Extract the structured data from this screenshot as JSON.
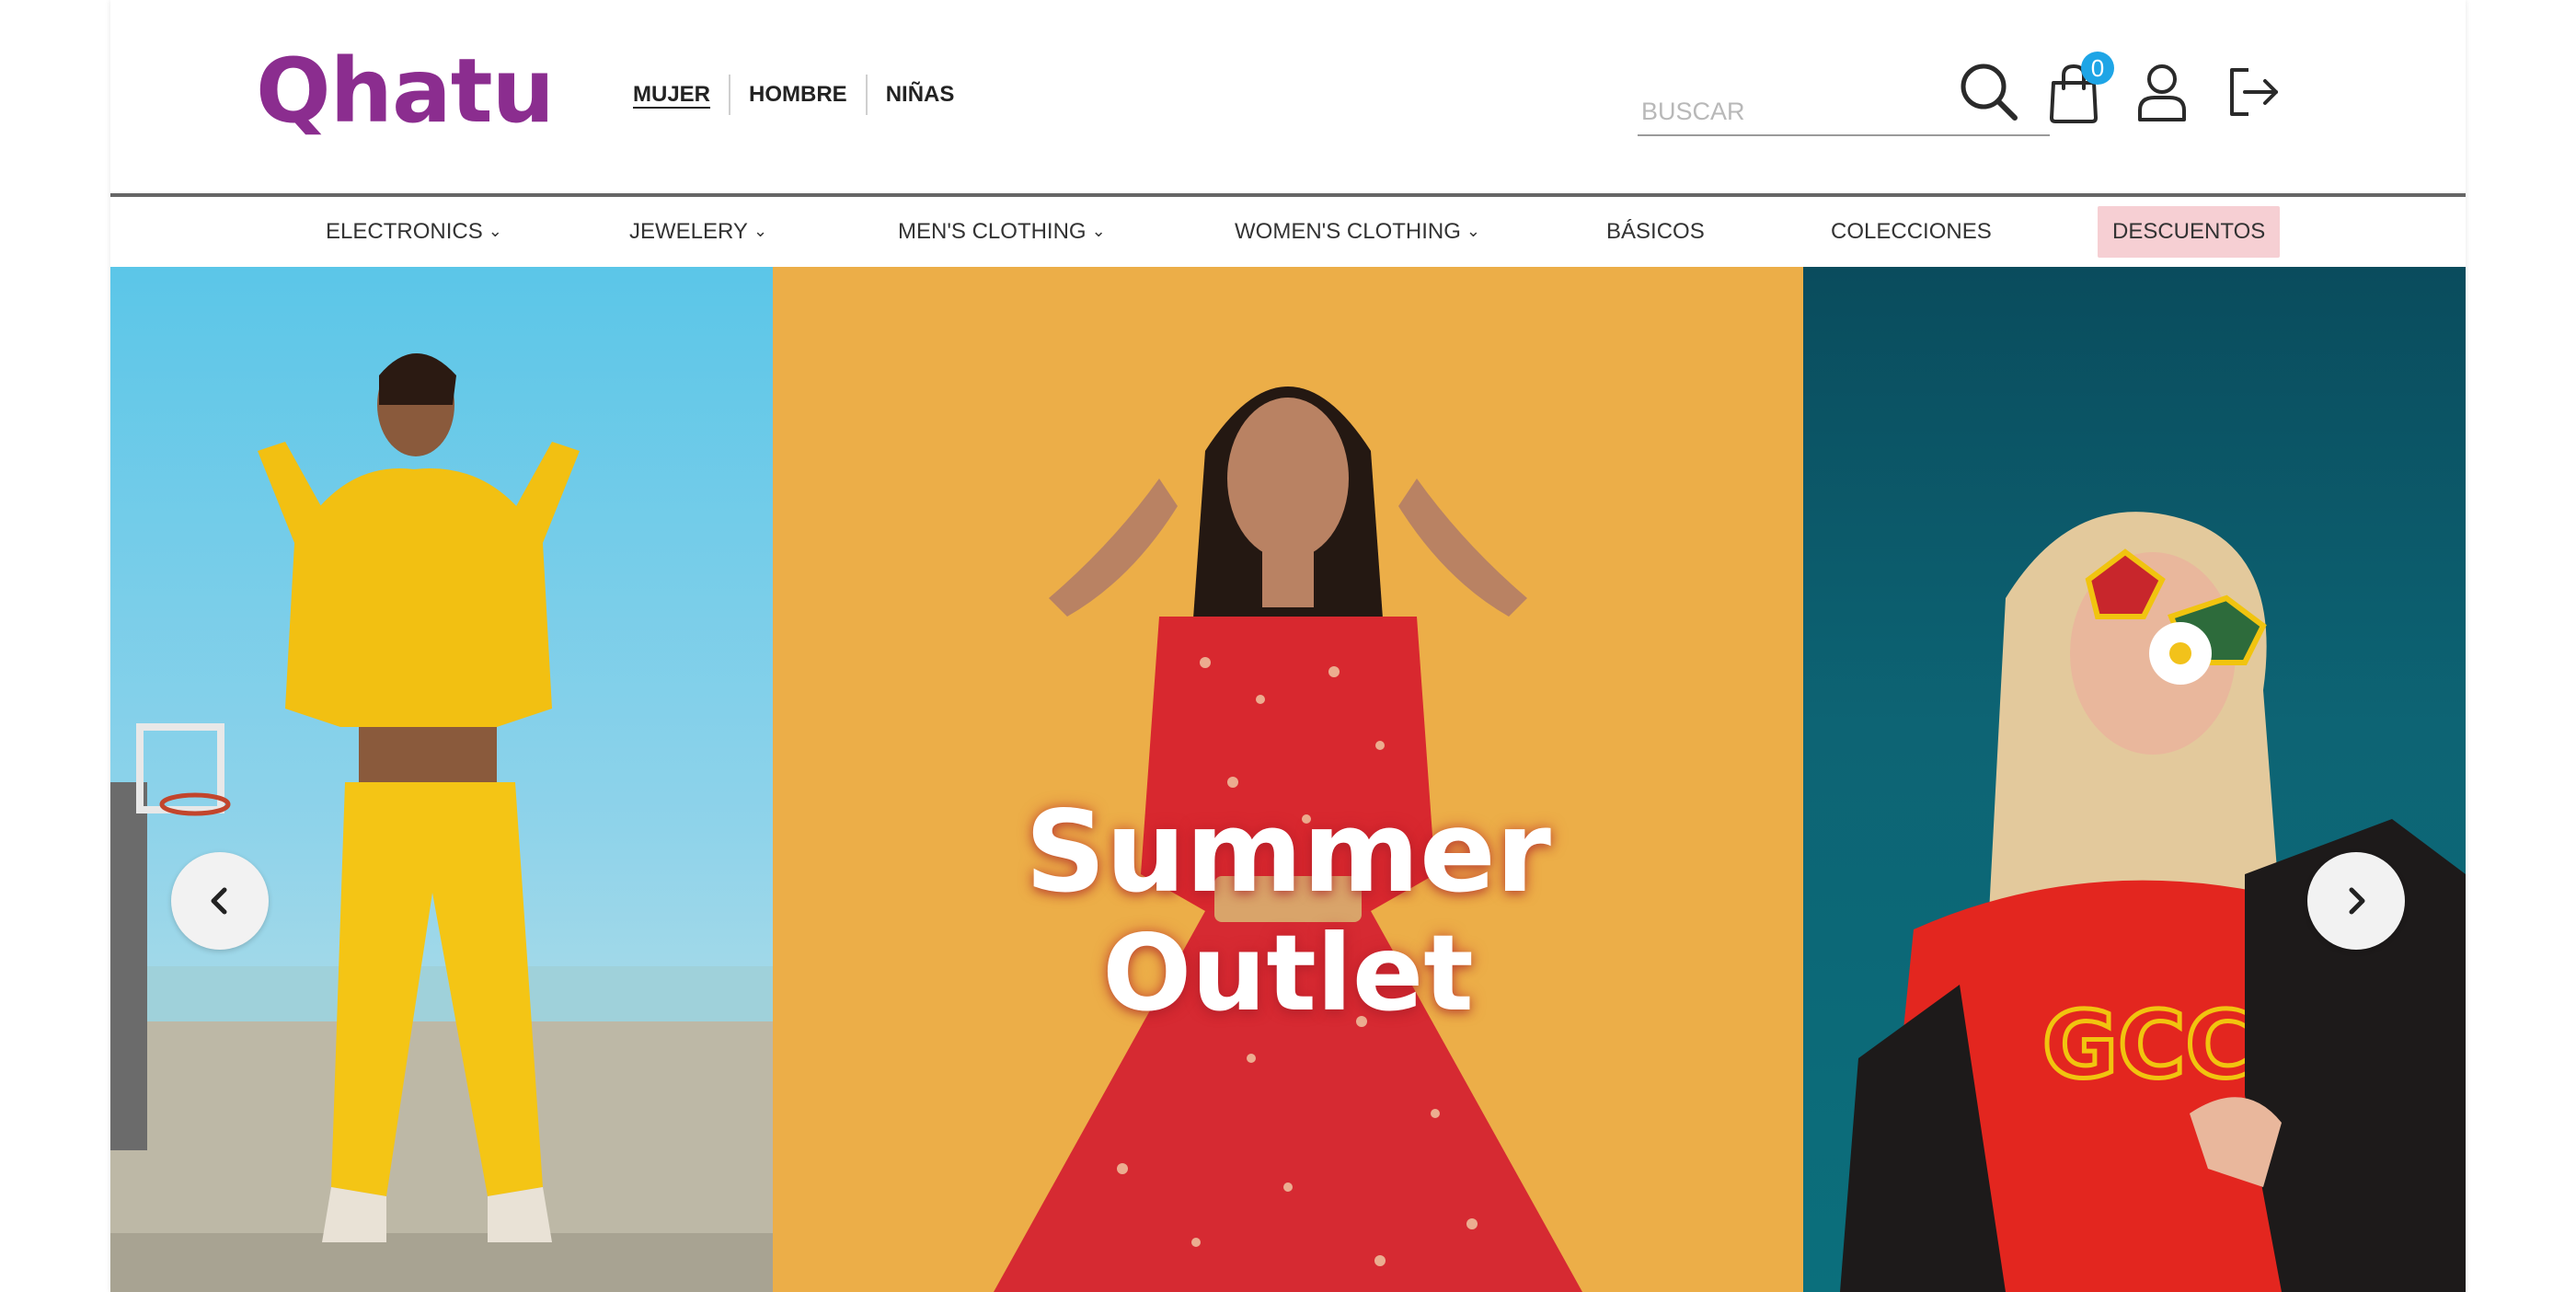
{
  "header": {
    "logo_text": "Qhatu",
    "brand_color": "#8b2d8f",
    "gender_nav": [
      {
        "label": "MUJER",
        "active": true
      },
      {
        "label": "HOMBRE",
        "active": false
      },
      {
        "label": "NIÑAS",
        "active": false
      }
    ],
    "search": {
      "placeholder": "BUSCAR",
      "value": ""
    },
    "icons": {
      "search": "search-icon",
      "cart": "shopping-bag-icon",
      "account": "user-icon",
      "logout": "logout-icon"
    },
    "cart_count": "0",
    "badge_color": "#1ea5e6"
  },
  "categories": [
    {
      "label": "ELECTRONICS",
      "dropdown": true
    },
    {
      "label": "JEWELERY",
      "dropdown": true
    },
    {
      "label": "MEN'S CLOTHING",
      "dropdown": true
    },
    {
      "label": "WOMEN'S CLOTHING",
      "dropdown": true
    },
    {
      "label": "BÁSICOS",
      "dropdown": false
    },
    {
      "label": "COLECCIONES",
      "dropdown": false
    },
    {
      "label": "DESCUENTOS",
      "dropdown": false,
      "highlight_color": "#f6cfd3"
    }
  ],
  "carousel": {
    "title_line1": "Summer",
    "title_line2": "Outlet",
    "prev_icon": "chevron-left-icon",
    "next_icon": "chevron-right-icon",
    "panel_colors": [
      "#5bc6e8",
      "#ecae48",
      "#0b6f7c"
    ]
  }
}
